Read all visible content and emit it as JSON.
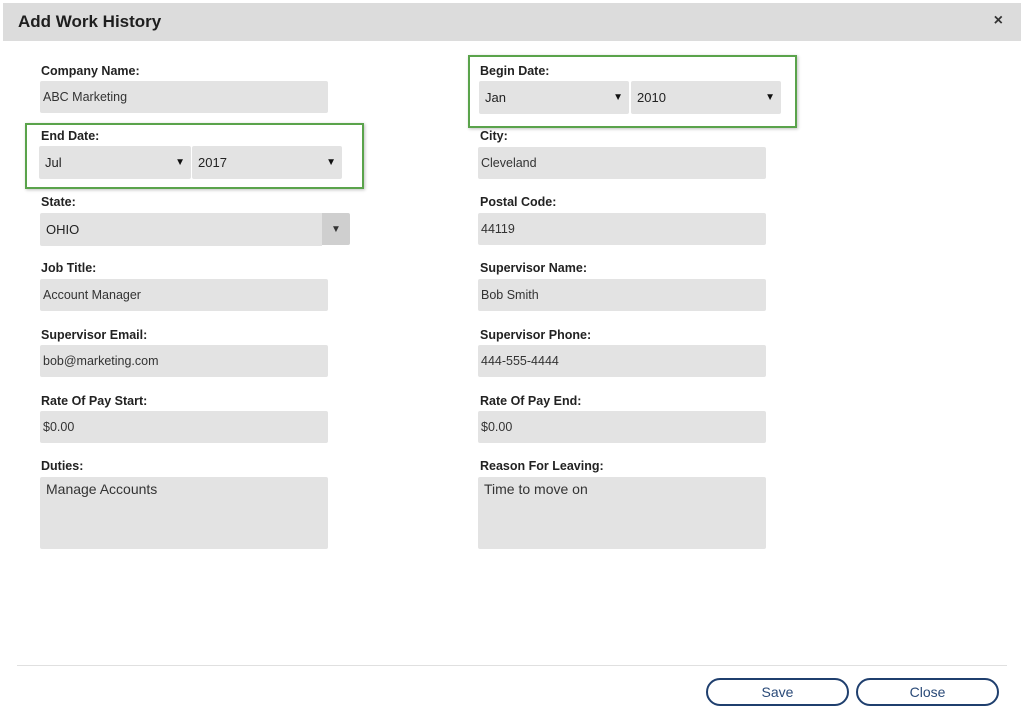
{
  "dialog": {
    "title": "Add Work History",
    "close_glyph": "×"
  },
  "form": {
    "company_name": {
      "label": "Company Name:",
      "value": "ABC Marketing"
    },
    "begin_date": {
      "label": "Begin Date:",
      "month": "Jan",
      "year": "2010"
    },
    "end_date": {
      "label": "End Date:",
      "month": "Jul",
      "year": "2017"
    },
    "city": {
      "label": "City:",
      "value": "Cleveland"
    },
    "state": {
      "label": "State:",
      "value": "OHIO"
    },
    "postal_code": {
      "label": "Postal Code:",
      "value": "44119"
    },
    "job_title": {
      "label": "Job Title:",
      "value": "Account Manager"
    },
    "supervisor_name": {
      "label": "Supervisor Name:",
      "value": "Bob Smith"
    },
    "supervisor_email": {
      "label": "Supervisor Email:",
      "value": "bob@marketing.com"
    },
    "supervisor_phone": {
      "label": "Supervisor Phone:",
      "value": "444-555-4444"
    },
    "rate_start": {
      "label": "Rate Of Pay Start:",
      "value": "$0.00"
    },
    "rate_end": {
      "label": "Rate Of Pay End:",
      "value": "$0.00"
    },
    "duties": {
      "label": "Duties:",
      "value": "Manage Accounts"
    },
    "reason_leaving": {
      "label": "Reason For Leaving:",
      "value": "Time to move on"
    }
  },
  "footer": {
    "save_label": "Save",
    "close_label": "Close"
  },
  "colors": {
    "highlight": "#5aa34b",
    "button_border": "#1f3f6e"
  },
  "icons": {
    "dropdown": "▼"
  }
}
